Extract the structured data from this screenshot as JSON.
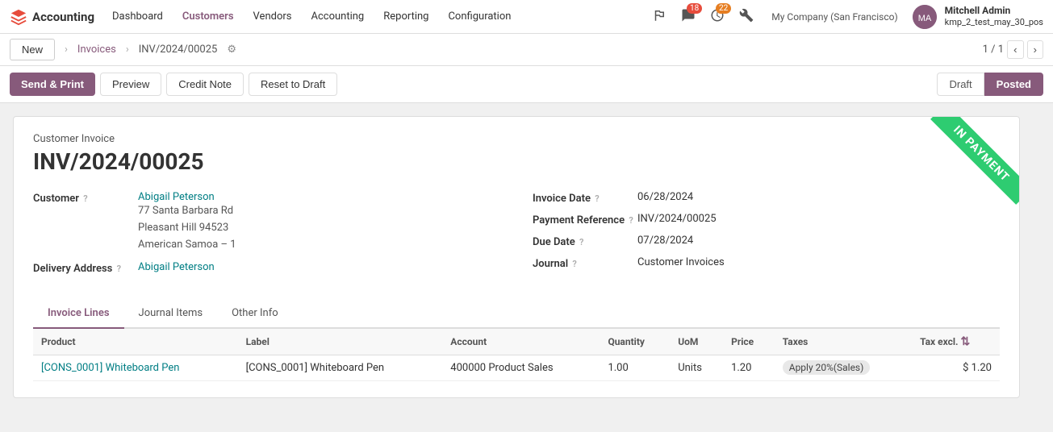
{
  "app": {
    "logo_text": "Accounting",
    "nav_items": [
      "Dashboard",
      "Customers",
      "Vendors",
      "Accounting",
      "Reporting",
      "Configuration"
    ],
    "notifications_chat": "18",
    "notifications_clock": "22",
    "company_name": "My Company (San Francisco)",
    "user_name": "Mitchell Admin",
    "user_db": "kmp_2_test_may_30_pos",
    "user_initials": "MA"
  },
  "breadcrumb": {
    "new_label": "New",
    "parent_label": "Invoices",
    "current_label": "INV/2024/00025"
  },
  "pagination": {
    "current": "1 / 1"
  },
  "toolbar": {
    "send_print_label": "Send & Print",
    "preview_label": "Preview",
    "credit_note_label": "Credit Note",
    "reset_to_draft_label": "Reset to Draft",
    "status_draft": "Draft",
    "status_posted": "Posted"
  },
  "invoice": {
    "type_label": "Customer Invoice",
    "number": "INV/2024/00025",
    "in_payment_text": "IN PAYMENT",
    "customer_label": "Customer",
    "customer_name": "Abigail Peterson",
    "customer_address_line1": "77 Santa Barbara Rd",
    "customer_address_line2": "Pleasant Hill 94523",
    "customer_address_line3": "American Samoa – 1",
    "delivery_address_label": "Delivery Address",
    "delivery_address_name": "Abigail Peterson",
    "invoice_date_label": "Invoice Date",
    "invoice_date_value": "06/28/2024",
    "payment_ref_label": "Payment Reference",
    "payment_ref_value": "INV/2024/00025",
    "due_date_label": "Due Date",
    "due_date_value": "07/28/2024",
    "journal_label": "Journal",
    "journal_value": "Customer Invoices"
  },
  "tabs": [
    {
      "id": "invoice-lines",
      "label": "Invoice Lines",
      "active": true
    },
    {
      "id": "journal-items",
      "label": "Journal Items",
      "active": false
    },
    {
      "id": "other-info",
      "label": "Other Info",
      "active": false
    }
  ],
  "table": {
    "columns": [
      "Product",
      "Label",
      "Account",
      "Quantity",
      "UoM",
      "Price",
      "Taxes",
      "Tax excl."
    ],
    "adjust_icon": "⇅",
    "rows": [
      {
        "product": "[CONS_0001] Whiteboard Pen",
        "label": "[CONS_0001] Whiteboard Pen",
        "account": "400000 Product Sales",
        "quantity": "1.00",
        "uom": "Units",
        "price": "1.20",
        "taxes": "Apply 20%(Sales)",
        "tax_excl": "$ 1.20"
      }
    ]
  }
}
